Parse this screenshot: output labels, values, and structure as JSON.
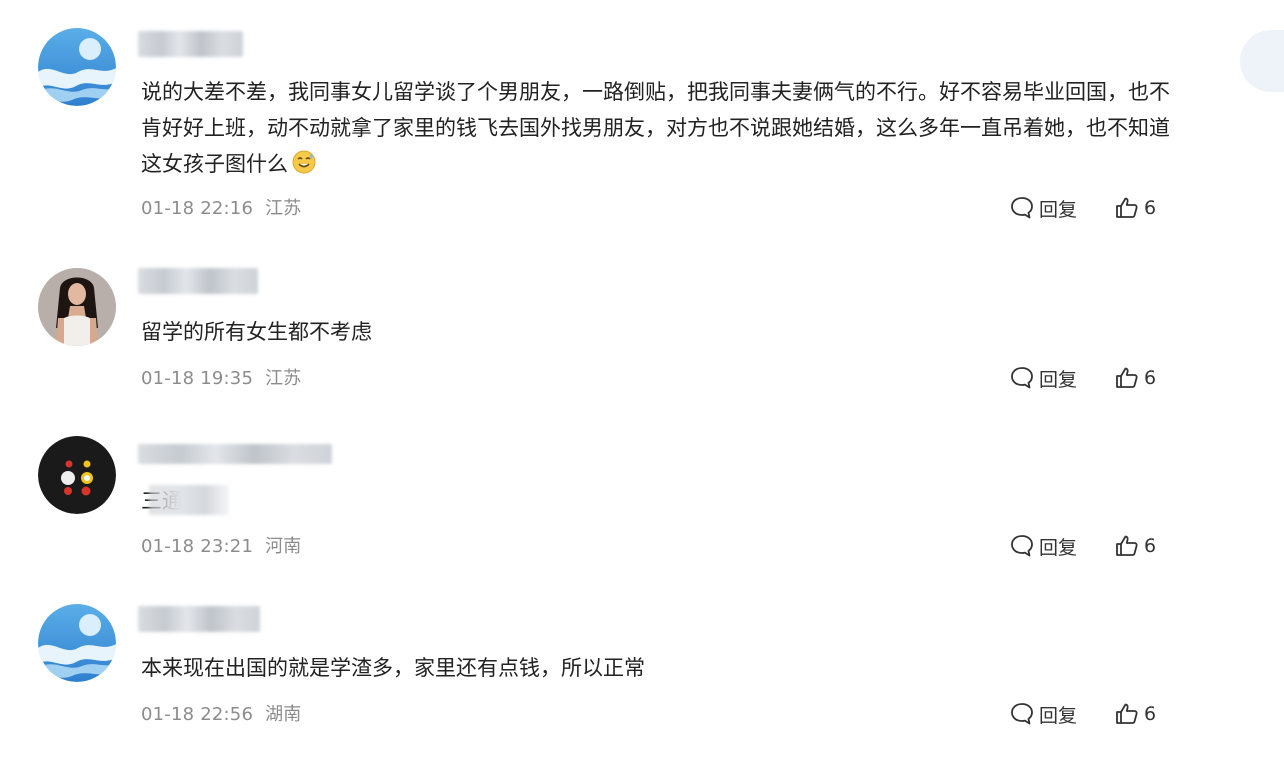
{
  "comments": [
    {
      "content": "说的大差不差，我同事女儿留学谈了个男朋友，一路倒贴，把我同事夫妻俩气的不行。好不容易毕业回国，也不肯好好上班，动不动就拿了家里的钱飞去国外找男朋友，对方也不说跟她结婚，这么多年一直吊着她，也不知道这女孩子图什么",
      "emoji": "sweat-smile-emoji",
      "time": "01-18 22:16",
      "location": "江苏",
      "reply_label": "回复",
      "likes": "6",
      "avatar": "blue-wave-avatar"
    },
    {
      "content": "留学的所有女生都不考虑",
      "time": "01-18 19:35",
      "location": "江苏",
      "reply_label": "回复",
      "likes": "6",
      "avatar": "woman-photo-avatar"
    },
    {
      "content": "三通",
      "time": "01-18 23:21",
      "location": "河南",
      "reply_label": "回复",
      "likes": "6",
      "avatar": "dark-dots-avatar"
    },
    {
      "content": "本来现在出国的就是学渣多，家里还有点钱，所以正常",
      "time": "01-18 22:56",
      "location": "湖南",
      "reply_label": "回复",
      "likes": "6",
      "avatar": "blue-wave-avatar"
    }
  ],
  "colors": {
    "text": "#222222",
    "meta": "#8c8c8c",
    "accent_blue": "#3d8ee0"
  }
}
